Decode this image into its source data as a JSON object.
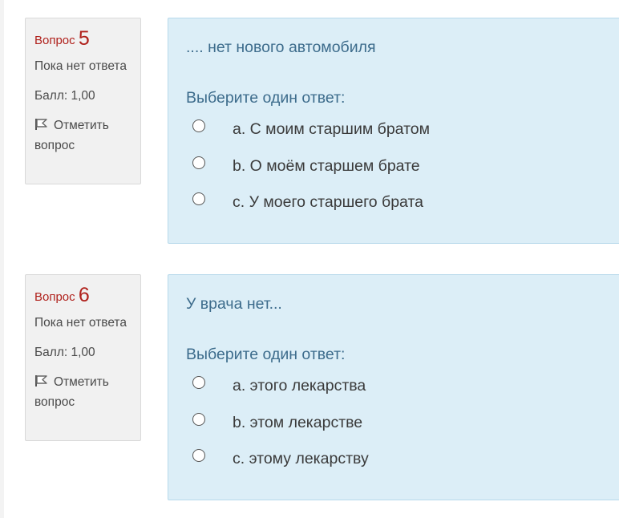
{
  "questions": [
    {
      "title_prefix": "Вопрос",
      "number": "5",
      "state": "Пока нет ответа",
      "grade": "Балл: 1,00",
      "flag_label": "Отметить вопрос",
      "text": ".... нет нового автомобиля",
      "prompt": "Выберите один ответ:",
      "options": [
        "a. С моим старшим братом",
        "b. О моём старшем брате",
        "c. У моего старшего брата"
      ]
    },
    {
      "title_prefix": "Вопрос",
      "number": "6",
      "state": "Пока нет ответа",
      "grade": "Балл: 1,00",
      "flag_label": "Отметить вопрос",
      "text": "У врача нет...",
      "prompt": "Выберите один ответ:",
      "options": [
        "a. этого лекарства",
        "b. этом лекарстве",
        "c. этому лекарству"
      ]
    }
  ],
  "colors": {
    "question_number": "#b0211c",
    "info_background": "#f1f1f1",
    "content_background": "#dceef7",
    "prompt_text": "#3d6c8c"
  },
  "icons": {
    "flag": "flag-icon",
    "radio": "radio-unchecked"
  }
}
